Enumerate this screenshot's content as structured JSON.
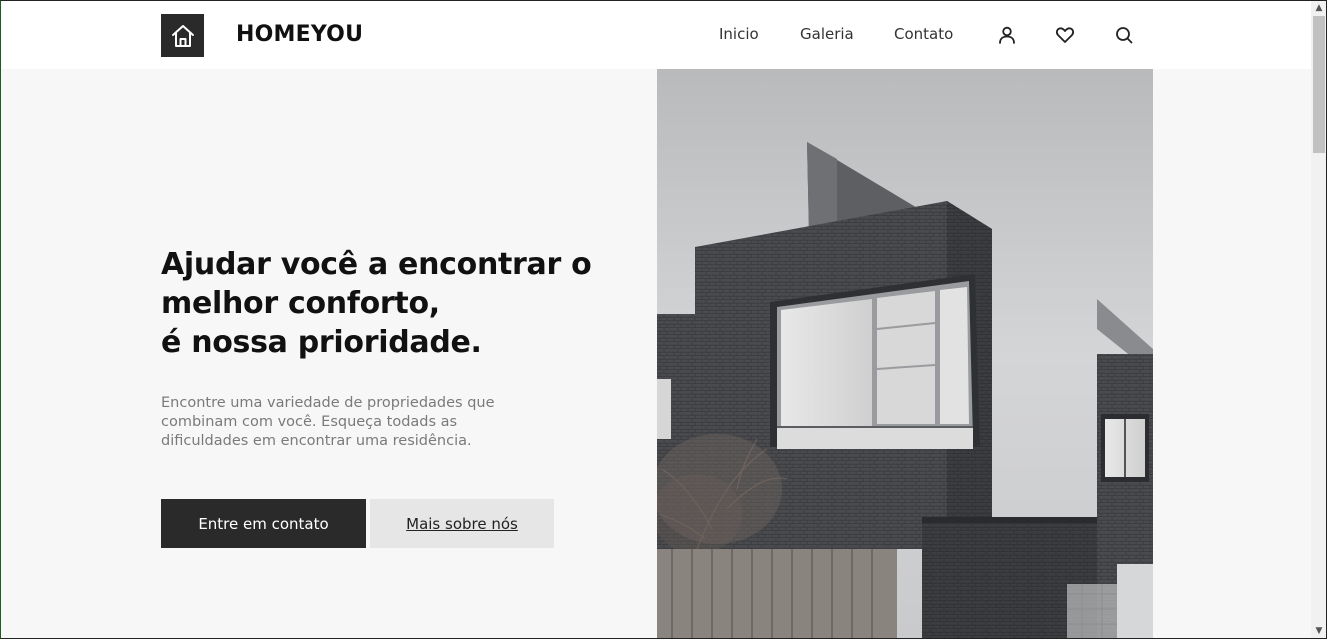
{
  "header": {
    "brand": "HOMEYOU",
    "nav": [
      {
        "label": "Inicio"
      },
      {
        "label": "Galeria"
      },
      {
        "label": "Contato"
      }
    ],
    "icons": [
      "user-icon",
      "heart-icon",
      "search-icon"
    ]
  },
  "hero": {
    "headline": [
      "Ajudar você a encontrar o",
      "melhor conforto,",
      "é nossa prioridade."
    ],
    "description": [
      "Encontre uma variedade de propriedades que",
      "combinam com você. Esqueça todads as",
      "dificuldades em encontrar uma residência."
    ],
    "primary_button": "Entre em contato",
    "secondary_button": "Mais sobre nós",
    "image": "modern-house-photo"
  },
  "colors": {
    "dark": "#2a2a2a",
    "hero_bg": "#f7f7f7",
    "secondary_btn_bg": "#e6e6e6",
    "muted_text": "#7a7a7a"
  }
}
